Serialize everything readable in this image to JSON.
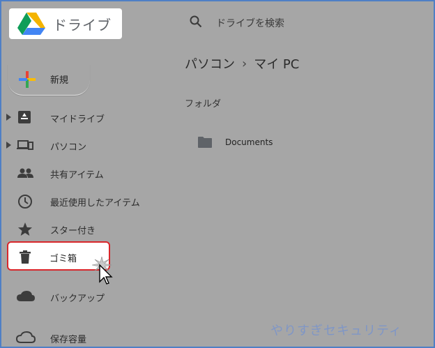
{
  "app": {
    "title": "ドライブ",
    "colors": {
      "highlight_border": "#d9262a",
      "frame_border": "#4f7fc5",
      "watermark": "#7f96c6"
    }
  },
  "search": {
    "placeholder": "ドライブを検索",
    "icon": "search-icon"
  },
  "breadcrumb": {
    "items": [
      "パソコン",
      "マイ PC"
    ],
    "separator": "›"
  },
  "main": {
    "section_heading": "フォルダ",
    "folders": [
      {
        "name": "Documents",
        "icon": "folder-icon"
      }
    ]
  },
  "sidebar": {
    "new_label": "新規",
    "items": [
      {
        "label": "マイドライブ",
        "icon": "my-drive-icon",
        "expandable": true
      },
      {
        "label": "パソコン",
        "icon": "computers-icon",
        "expandable": true
      },
      {
        "label": "共有アイテム",
        "icon": "shared-people-icon",
        "expandable": false
      },
      {
        "label": "最近使用したアイテム",
        "icon": "clock-icon",
        "expandable": false
      },
      {
        "label": "スター付き",
        "icon": "star-icon",
        "expandable": false
      },
      {
        "label": "ゴミ箱",
        "icon": "trash-icon",
        "expandable": false,
        "highlighted": true
      },
      {
        "label": "バックアップ",
        "icon": "cloud-icon",
        "expandable": false
      },
      {
        "label": "保存容量",
        "icon": "cloud-outline-icon",
        "expandable": false
      }
    ]
  },
  "watermark": "やりすぎセキュリティ"
}
